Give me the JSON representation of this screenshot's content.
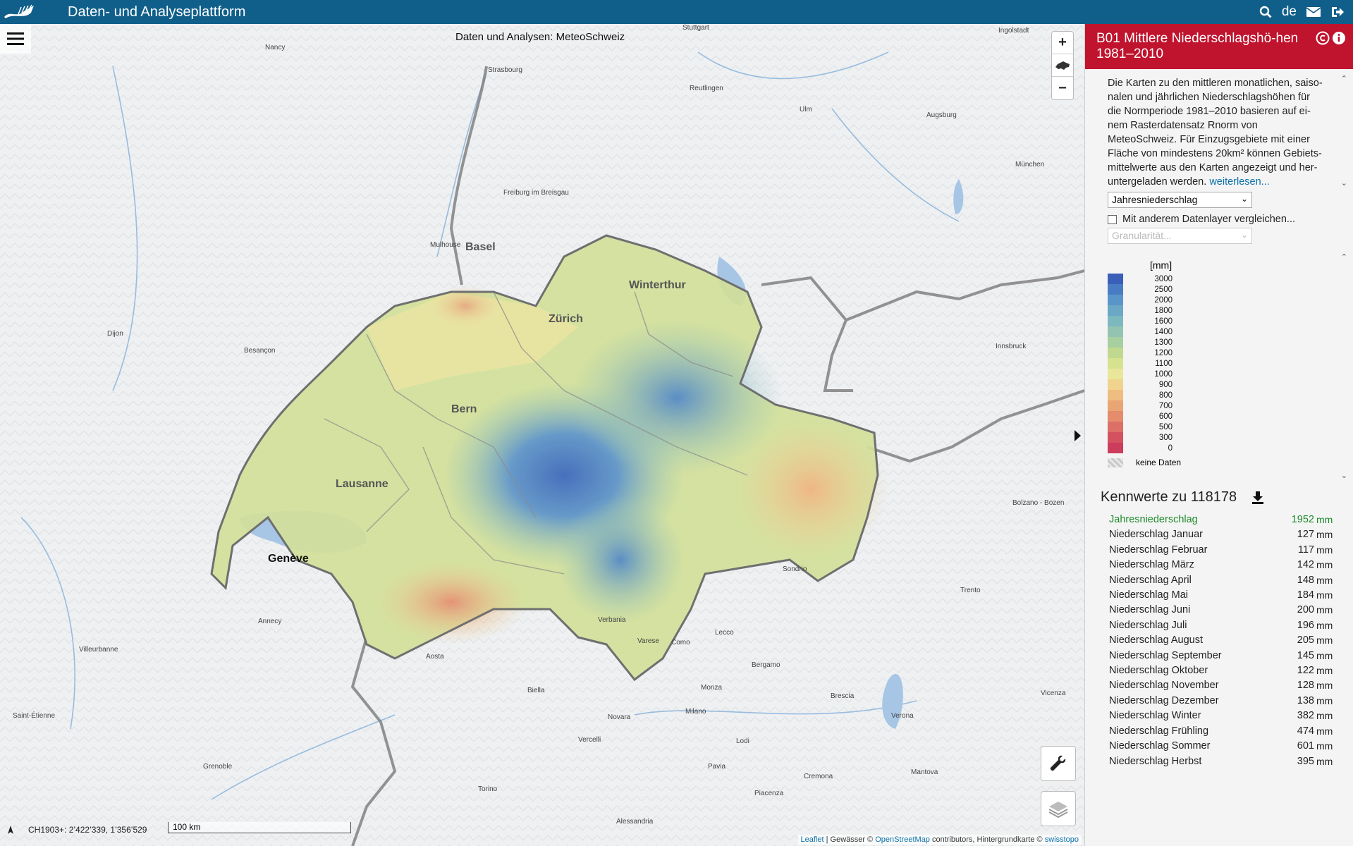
{
  "header": {
    "app_title": "Daten- und Analyseplattform",
    "language": "de",
    "icons": [
      "search-icon",
      "mail-icon",
      "logout-icon"
    ]
  },
  "map": {
    "title": "Daten und Analysen: MeteoSchweiz",
    "coordinates": "CH1903+: 2’422’339, 1’356’529",
    "scale_label": "100 km",
    "attribution": {
      "leaflet": "Leaflet",
      "text1": " | Gewässer © ",
      "osm": "OpenStreetMap",
      "text2": " contributors, Hintergrundkarte © ",
      "swisstopo": "swisstopo"
    },
    "cities": {
      "basel": "Basel",
      "winterthur": "Winterthur",
      "zurich": "Zürich",
      "bern": "Bern",
      "lausanne": "Lausanne",
      "geneve": "Genève"
    },
    "places": [
      "Nancy",
      "Stuttgart",
      "Ingolstadt",
      "Strasbourg",
      "Reutlingen",
      "Ulm",
      "Augsburg",
      "München",
      "Freiburg im Breisgau",
      "Mulhouse",
      "Dijon",
      "Besançon",
      "Innsbruck",
      "Bolzano - Bozen",
      "Trento",
      "Sondrio",
      "Verbania",
      "Varese",
      "Como",
      "Lecco",
      "Bergamo",
      "Brescia",
      "Verona",
      "Vicenza",
      "Aosta",
      "Biella",
      "Novara",
      "Milano",
      "Monza",
      "Vercelli",
      "Lodi",
      "Pavia",
      "Cremona",
      "Mantova",
      "Piacenza",
      "Torino",
      "Alessandria",
      "Grenoble",
      "Annecy",
      "Villeurbanne",
      "Saint-Étienne"
    ]
  },
  "panel": {
    "title": "B01 Mittlere Niederschlagshö-hen 1981–2010",
    "description": "Die Karten zu den mittleren monatlichen, saiso-nalen und jährlichen Niederschlagshöhen für die Normperiode 1981–2010 basieren auf ei-nem Rasterdatensatz Rnorm von MeteoSchweiz. Für Einzugsgebiete mit einer Fläche von mindestens 20km² können Gebiets-mittelwerte aus den Karten angezeigt und her-untergeladen werden. ",
    "read_more": "weiterlesen...",
    "dropdown_value": "Jahresniederschlag",
    "compare_label": "Mit anderem Datenlayer vergleichen...",
    "granularity_placeholder": "Granularität...",
    "legend": {
      "unit": "[mm]",
      "values": [
        "3000",
        "2500",
        "2000",
        "1800",
        "1600",
        "1400",
        "1300",
        "1200",
        "1100",
        "1000",
        "900",
        "800",
        "700",
        "600",
        "500",
        "300",
        "0"
      ],
      "colors": [
        "#3a5fb8",
        "#4a7cc4",
        "#5a95c9",
        "#6aa8c6",
        "#7db8bf",
        "#93c4b1",
        "#a8cf9f",
        "#c0d98f",
        "#d7e28f",
        "#e9e69a",
        "#f0d48e",
        "#efbd80",
        "#eaa575",
        "#e48c6c",
        "#dc7068",
        "#d45260",
        "#cc3c5c"
      ],
      "nodata_label": "keine Daten"
    },
    "kennwerte_title": "Kennwerte zu 118178",
    "kennwerte": [
      {
        "label": "Jahresniederschlag",
        "value": "1952",
        "unit": "mm"
      },
      {
        "label": "Niederschlag Januar",
        "value": "127",
        "unit": "mm"
      },
      {
        "label": "Niederschlag Februar",
        "value": "117",
        "unit": "mm"
      },
      {
        "label": "Niederschlag März",
        "value": "142",
        "unit": "mm"
      },
      {
        "label": "Niederschlag April",
        "value": "148",
        "unit": "mm"
      },
      {
        "label": "Niederschlag Mai",
        "value": "184",
        "unit": "mm"
      },
      {
        "label": "Niederschlag Juni",
        "value": "200",
        "unit": "mm"
      },
      {
        "label": "Niederschlag Juli",
        "value": "196",
        "unit": "mm"
      },
      {
        "label": "Niederschlag August",
        "value": "205",
        "unit": "mm"
      },
      {
        "label": "Niederschlag September",
        "value": "145",
        "unit": "mm"
      },
      {
        "label": "Niederschlag Oktober",
        "value": "122",
        "unit": "mm"
      },
      {
        "label": "Niederschlag November",
        "value": "128",
        "unit": "mm"
      },
      {
        "label": "Niederschlag Dezember",
        "value": "138",
        "unit": "mm"
      },
      {
        "label": "Niederschlag Winter",
        "value": "382",
        "unit": "mm"
      },
      {
        "label": "Niederschlag Frühling",
        "value": "474",
        "unit": "mm"
      },
      {
        "label": "Niederschlag Sommer",
        "value": "601",
        "unit": "mm"
      },
      {
        "label": "Niederschlag Herbst",
        "value": "395",
        "unit": "mm"
      }
    ],
    "active_color": "#1d8a2a"
  }
}
